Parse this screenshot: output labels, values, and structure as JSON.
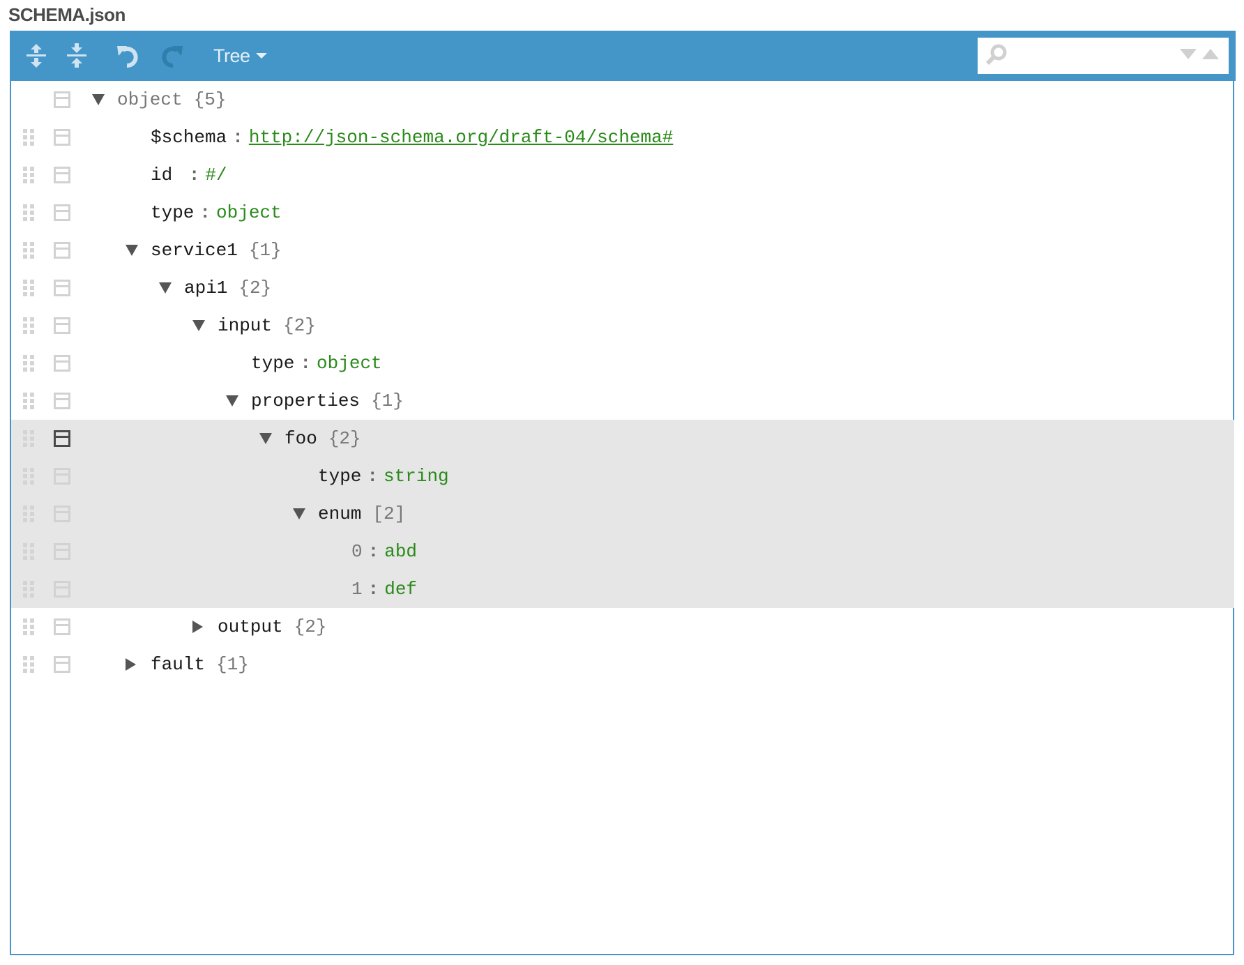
{
  "title": "SCHEMA.json",
  "colors": {
    "toolbar": "#4396c7",
    "value": "#2a8a1a",
    "highlight": "#e6e6e6"
  },
  "toolbar": {
    "expand_all_icon": "expand-all-icon",
    "collapse_all_icon": "collapse-all-icon",
    "undo_icon": "undo-icon",
    "redo_icon": "redo-icon",
    "mode_label": "Tree",
    "search_placeholder": "",
    "search_value": ""
  },
  "rows": [
    {
      "key": "object",
      "count": "{5}",
      "level": 0,
      "expander": "down",
      "root": true
    },
    {
      "key": "$schema",
      "value": "http://json-schema.org/draft-04/schema#",
      "level": 1,
      "link": true
    },
    {
      "key": "id ",
      "value": "#/",
      "level": 1
    },
    {
      "key": "type",
      "value": "object",
      "level": 1
    },
    {
      "key": "service1",
      "count": "{1}",
      "level": 1,
      "expander": "down"
    },
    {
      "key": "api1",
      "count": "{2}",
      "level": 2,
      "expander": "down"
    },
    {
      "key": "input",
      "count": "{2}",
      "level": 3,
      "expander": "down"
    },
    {
      "key": "type",
      "value": "object",
      "level": 4
    },
    {
      "key": "properties",
      "count": "{1}",
      "level": 4,
      "expander": "down"
    },
    {
      "key": "foo",
      "count": "{2}",
      "level": 5,
      "expander": "down",
      "highlighted": true,
      "selected": true
    },
    {
      "key": "type",
      "value": "string",
      "level": 6,
      "highlighted": true
    },
    {
      "key": "enum",
      "count": "[2]",
      "level": 6,
      "expander": "down",
      "highlighted": true
    },
    {
      "key": "0",
      "value": "abd",
      "level": 7,
      "index": true,
      "highlighted": true
    },
    {
      "key": "1",
      "value": "def",
      "level": 7,
      "index": true,
      "highlighted": true
    },
    {
      "key": "output",
      "count": "{2}",
      "level": 3,
      "expander": "right"
    },
    {
      "key": "fault",
      "count": "{1}",
      "level": 1,
      "expander": "right"
    }
  ]
}
